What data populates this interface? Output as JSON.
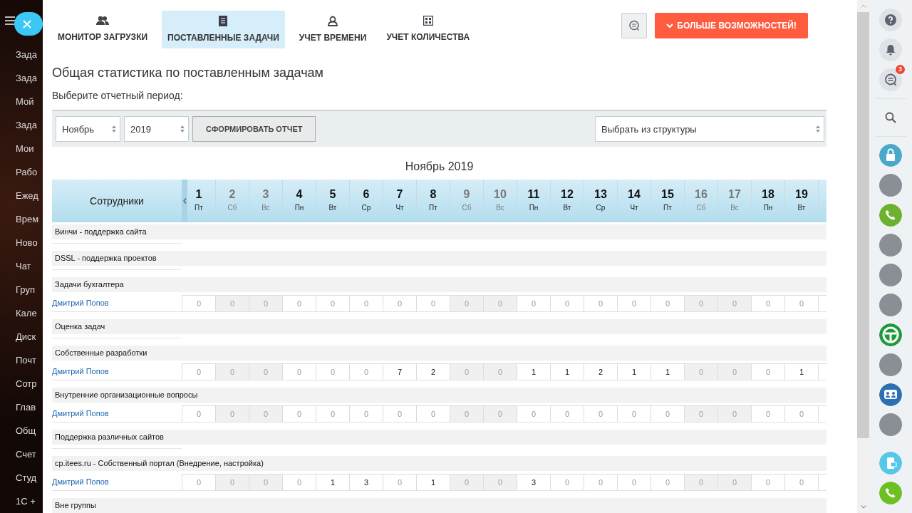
{
  "left_menu": {
    "items": [
      "Зада",
      "Зада",
      "Мой",
      "Зада",
      "Мои",
      "Рабо",
      "Ежед",
      "Врем",
      "Ново",
      "Чат",
      "Груп",
      "Кале",
      "Диск",
      "Почт",
      "Сотр",
      "Глав",
      "Общ",
      "Счет",
      "Студ",
      "1С +"
    ]
  },
  "tabs": [
    {
      "label": "МОНИТОР ЗАГРУЗКИ",
      "selected": false
    },
    {
      "label": "ПОСТАВЛЕННЫЕ ЗАДАЧИ",
      "selected": true
    },
    {
      "label": "УЧЕТ ВРЕМЕНИ",
      "selected": false
    },
    {
      "label": "УЧЕТ КОЛИЧЕСТВА",
      "selected": false
    }
  ],
  "more_button": {
    "label": "БОЛЬШЕ ВОЗМОЖНОСТЕЙ!"
  },
  "page_title": "Общая статистика по поставленным задачам",
  "period_label": "Выберите отчетный период:",
  "filters": {
    "month": "Ноябрь",
    "year": "2019",
    "submit": "СФОРМИРОВАТЬ ОТЧЕТ",
    "structure": "Выбрать из структуры"
  },
  "report_title": "Ноябрь 2019",
  "table": {
    "name_column": "Сотрудники",
    "days": [
      {
        "day": "1",
        "weekday": "Пт",
        "weekend": false
      },
      {
        "day": "2",
        "weekday": "Сб",
        "weekend": true
      },
      {
        "day": "3",
        "weekday": "Вс",
        "weekend": true
      },
      {
        "day": "4",
        "weekday": "Пн",
        "weekend": false
      },
      {
        "day": "5",
        "weekday": "Вт",
        "weekend": false
      },
      {
        "day": "6",
        "weekday": "Ср",
        "weekend": false
      },
      {
        "day": "7",
        "weekday": "Чт",
        "weekend": false
      },
      {
        "day": "8",
        "weekday": "Пт",
        "weekend": false
      },
      {
        "day": "9",
        "weekday": "Сб",
        "weekend": true
      },
      {
        "day": "10",
        "weekday": "Вс",
        "weekend": true
      },
      {
        "day": "11",
        "weekday": "Пн",
        "weekend": false
      },
      {
        "day": "12",
        "weekday": "Вт",
        "weekend": false
      },
      {
        "day": "13",
        "weekday": "Ср",
        "weekend": false
      },
      {
        "day": "14",
        "weekday": "Чт",
        "weekend": false
      },
      {
        "day": "15",
        "weekday": "Пт",
        "weekend": false
      },
      {
        "day": "16",
        "weekday": "Сб",
        "weekend": true
      },
      {
        "day": "17",
        "weekday": "Вс",
        "weekend": true
      },
      {
        "day": "18",
        "weekday": "Пн",
        "weekend": false
      },
      {
        "day": "19",
        "weekday": "Вт",
        "weekend": false
      }
    ],
    "rows": [
      {
        "kind": "group",
        "label": "Винчи - поддержка сайта"
      },
      {
        "kind": "group",
        "label": "DSSL - поддержка проектов"
      },
      {
        "kind": "group",
        "label": "Задачи бухгалтера"
      },
      {
        "kind": "employee",
        "name": "Дмитрий Попов",
        "values": [
          "0",
          "0",
          "0",
          "0",
          "0",
          "0",
          "0",
          "0",
          "0",
          "0",
          "0",
          "0",
          "0",
          "0",
          "0",
          "0",
          "0",
          "0",
          "0"
        ]
      },
      {
        "kind": "group",
        "label": "Оценка задач"
      },
      {
        "kind": "group",
        "label": "Собственные разработки"
      },
      {
        "kind": "employee",
        "name": "Дмитрий Попов",
        "values": [
          "0",
          "0",
          "0",
          "0",
          "0",
          "0",
          "7",
          "2",
          "0",
          "0",
          "1",
          "1",
          "2",
          "1",
          "1",
          "0",
          "0",
          "0",
          "1"
        ]
      },
      {
        "kind": "group",
        "label": "Внутренние организационные вопросы"
      },
      {
        "kind": "employee",
        "name": "Дмитрий Попов",
        "values": [
          "0",
          "0",
          "0",
          "0",
          "0",
          "0",
          "0",
          "0",
          "0",
          "0",
          "0",
          "0",
          "0",
          "0",
          "0",
          "0",
          "0",
          "0",
          "0"
        ]
      },
      {
        "kind": "group",
        "label": "Поддержка различных сайтов"
      },
      {
        "kind": "group",
        "label": "cp.itees.ru - Собственный портал (Внедрение, настройка)"
      },
      {
        "kind": "employee",
        "name": "Дмитрий Попов",
        "values": [
          "0",
          "0",
          "0",
          "0",
          "1",
          "3",
          "0",
          "1",
          "0",
          "0",
          "3",
          "0",
          "0",
          "0",
          "0",
          "0",
          "0",
          "0",
          "0"
        ]
      },
      {
        "kind": "group",
        "label": "Вне группы"
      }
    ]
  },
  "right_bar": {
    "chat_badge": "3"
  }
}
